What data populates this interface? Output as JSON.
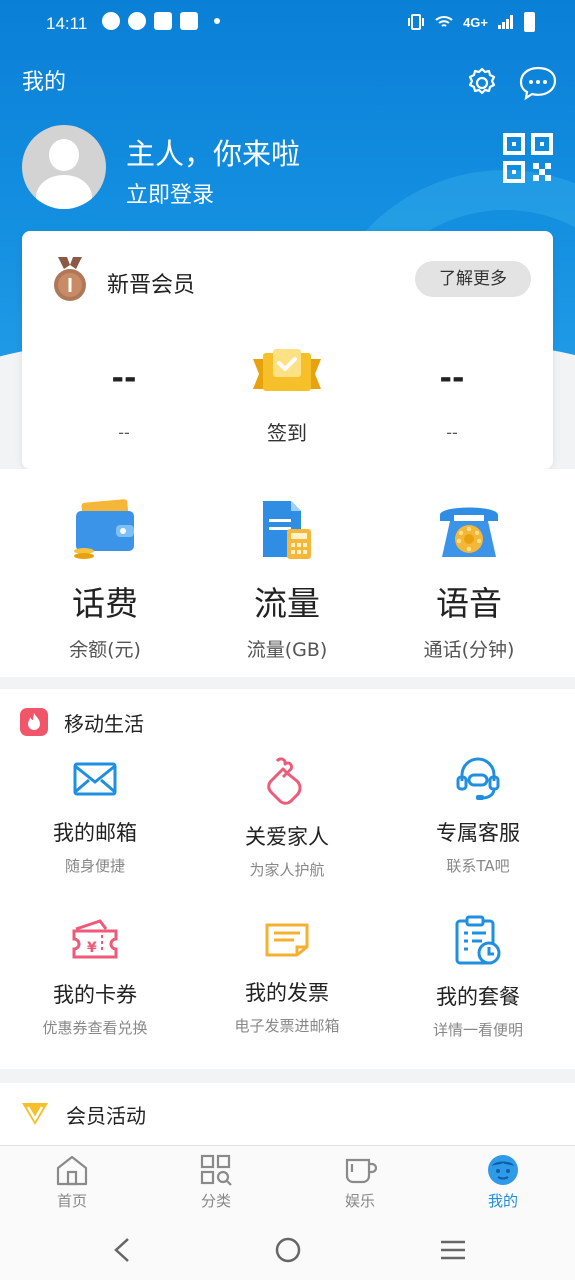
{
  "status_bar": {
    "time": "14:11",
    "network": "4G+"
  },
  "header": {
    "title": "我的",
    "greeting": "主人，你来啦",
    "login_label": "立即登录"
  },
  "member_card": {
    "level_title": "新晋会员",
    "more_button": "了解更多",
    "left_value": "--",
    "left_label": "--",
    "signin_label": "签到",
    "right_value": "--",
    "right_label": "--"
  },
  "quick_stats": [
    {
      "title": "话费",
      "subtitle": "余额(元)",
      "icon": "wallet-icon"
    },
    {
      "title": "流量",
      "subtitle": "流量(GB)",
      "icon": "document-calculator-icon"
    },
    {
      "title": "语音",
      "subtitle": "通话(分钟)",
      "icon": "telephone-icon"
    }
  ],
  "mobile_life": {
    "title": "移动生活",
    "items": [
      {
        "title": "我的邮箱",
        "subtitle": "随身便捷",
        "icon": "mail-icon"
      },
      {
        "title": "关爱家人",
        "subtitle": "为家人护航",
        "icon": "hand-heart-icon"
      },
      {
        "title": "专属客服",
        "subtitle": "联系TA吧",
        "icon": "headset-icon"
      },
      {
        "title": "我的卡券",
        "subtitle": "优惠券查看兑换",
        "icon": "coupon-icon"
      },
      {
        "title": "我的发票",
        "subtitle": "电子发票进邮箱",
        "icon": "invoice-icon"
      },
      {
        "title": "我的套餐",
        "subtitle": "详情一看便明",
        "icon": "plan-clock-icon"
      }
    ]
  },
  "member_activity": {
    "title": "会员活动"
  },
  "tabbar": [
    {
      "label": "首页",
      "icon": "home-icon"
    },
    {
      "label": "分类",
      "icon": "category-icon"
    },
    {
      "label": "娱乐",
      "icon": "cup-icon"
    },
    {
      "label": "我的",
      "icon": "mine-icon",
      "active": true
    }
  ],
  "colors": {
    "brand_blue": "#138ee0",
    "active_tab": "#1f8fe0",
    "fire_red": "#f0556a"
  }
}
